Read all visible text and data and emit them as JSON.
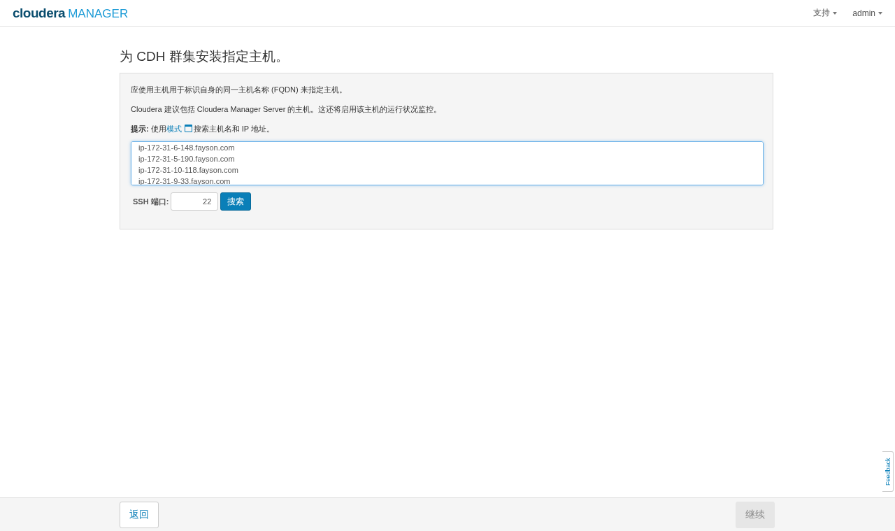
{
  "header": {
    "logo_brand": "cloudera",
    "logo_product": "MANAGER",
    "menus": [
      {
        "label": "支持"
      },
      {
        "label": "admin"
      }
    ]
  },
  "title": "为 CDH 群集安装指定主机。",
  "panel": {
    "intro": "应使用主机用于标识自身的同一主机名称 (FQDN) 来指定主机。",
    "recommend": "Cloudera 建议包括 Cloudera Manager Server 的主机。这还将启用该主机的运行状况监控。",
    "hint": {
      "before": "**提示:** 使用",
      "link": "模式",
      "after": "搜索主机名和 IP 地址。"
    },
    "hosts": [
      "ip-172-31-6-148.fayson.com",
      "ip-172-31-5-190.fayson.com",
      "ip-172-31-10-118.fayson.com",
      "ip-172-31-9-33.fayson.com"
    ],
    "ssh_label": "SSH 端口:",
    "ssh_port": "22",
    "search_button": "搜索"
  },
  "footer": {
    "back": {
      "label": "返回",
      "disabled": false
    },
    "continue": {
      "label": "继续",
      "disabled": true
    }
  },
  "feedback": "Feedback"
}
